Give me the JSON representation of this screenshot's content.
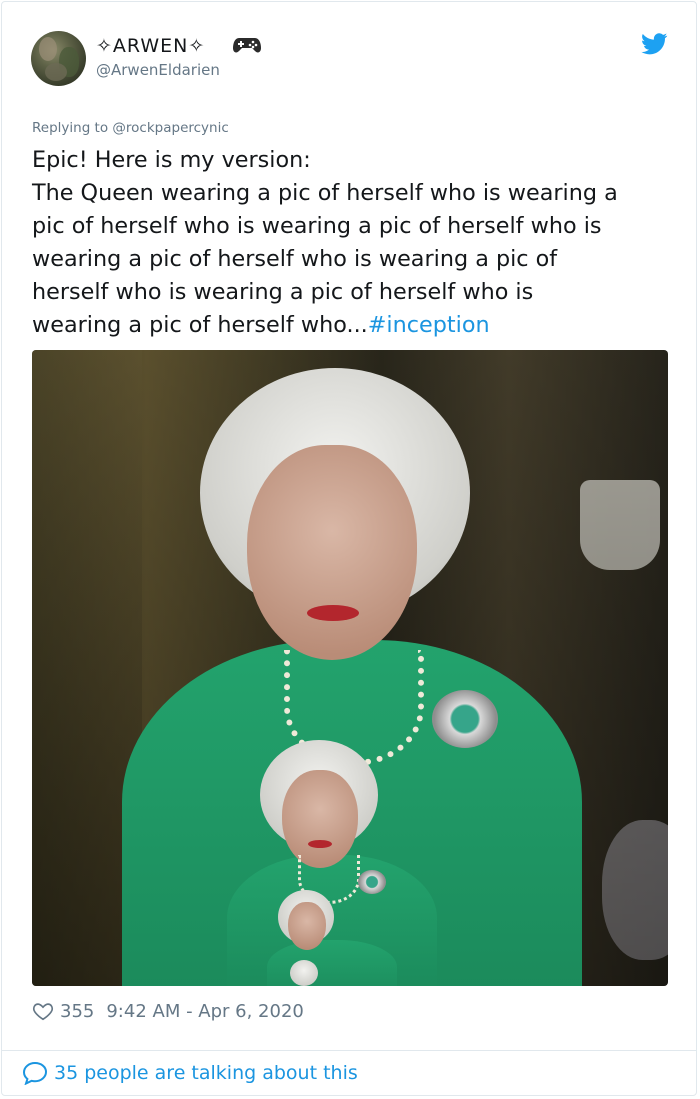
{
  "author": {
    "display_name": "✧ARWEN✧",
    "handle": "@ArwenEldarien",
    "avatar_icon": "user-avatar",
    "name_icon": "game-controller-icon"
  },
  "brand_icon": "twitter-bird-icon",
  "reply": {
    "label": "Replying to @rockpapercynic"
  },
  "tweet": {
    "lines": [
      "Epic! Here is my version:",
      "The Queen wearing a pic of herself who is wearing a",
      "pic of herself who is wearing a pic of herself who is",
      "wearing a pic of herself who is wearing a pic of",
      "herself who is wearing a pic of herself who is",
      "wearing a pic of herself who..."
    ],
    "hashtag": "#inception"
  },
  "stats": {
    "likes": "355",
    "timestamp": "9:42 AM - Apr 6, 2020"
  },
  "footer": {
    "talking": "35 people are talking about this"
  },
  "colors": {
    "accent": "#1b95e0",
    "muted": "#657786",
    "text": "#14171a",
    "border": "#e1e8ed"
  }
}
